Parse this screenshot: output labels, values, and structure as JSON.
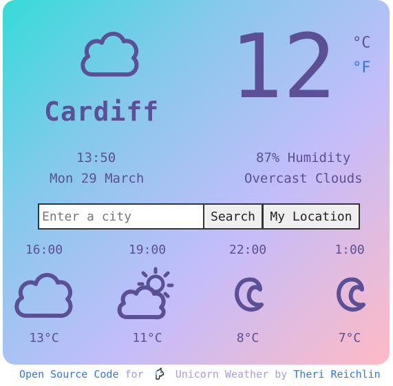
{
  "current": {
    "icon": "cloud-icon",
    "city": "Cardiff",
    "temperature": "12",
    "unit_celsius": "°C",
    "unit_fahrenheit": "°F",
    "time": "13:50",
    "date": "Mon 29 March",
    "humidity": "87% Humidity",
    "description": "Overcast Clouds"
  },
  "search": {
    "placeholder": "Enter a city",
    "value": "",
    "search_label": "Search",
    "location_label": "My Location"
  },
  "forecast": [
    {
      "time": "16:00",
      "icon": "cloud-icon",
      "temp": "13°C"
    },
    {
      "time": "19:00",
      "icon": "sun-behind-cloud-icon",
      "temp": "11°C"
    },
    {
      "time": "22:00",
      "icon": "moon-icon",
      "temp": "8°C"
    },
    {
      "time": "1:00",
      "icon": "moon-icon",
      "temp": "7°C"
    }
  ],
  "footer": {
    "open_source": "Open Source Code",
    "for_text": "for",
    "app_name": "Unicorn Weather",
    "by_text": "by",
    "author": "Theri Reichlin",
    "logo_icon": "unicorn-icon"
  },
  "colors": {
    "primary_text": "#5b4f96",
    "link": "#2f77e8",
    "muted_link": "#a99be8"
  }
}
